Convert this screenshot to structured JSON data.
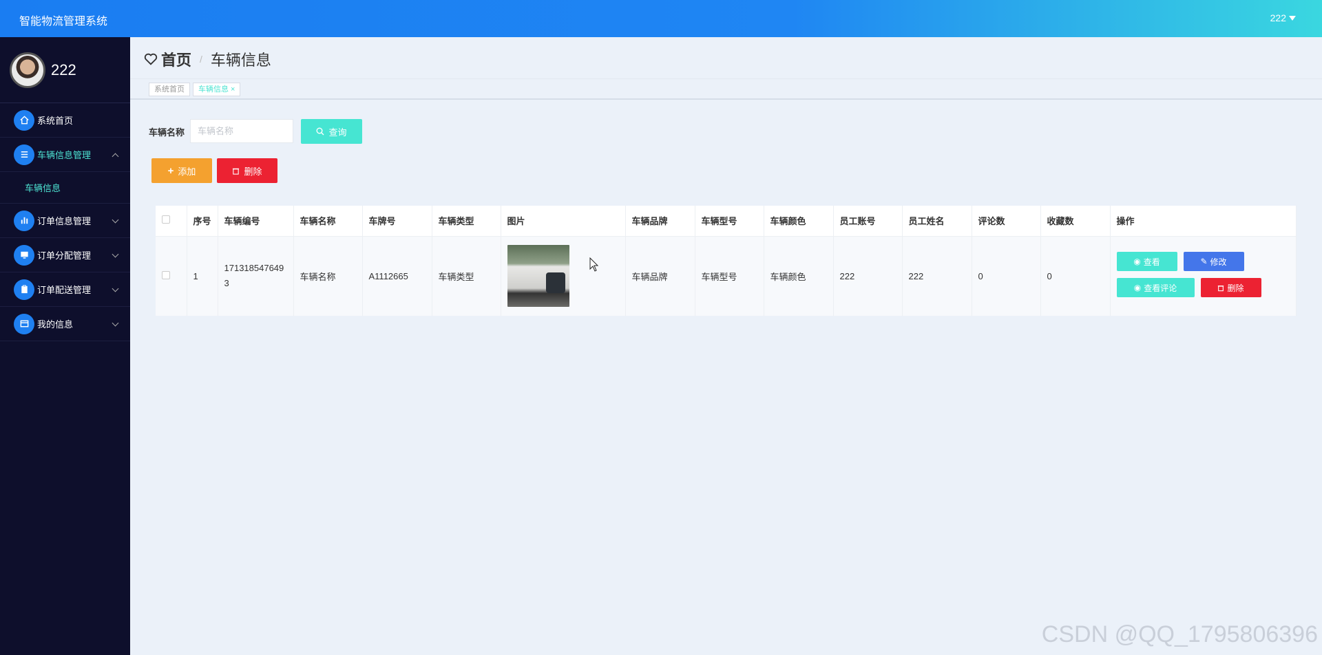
{
  "header": {
    "app_title": "智能物流管理系统",
    "user_label": "222"
  },
  "sidebar": {
    "profile_name": "222",
    "items": [
      {
        "label": "系统首页"
      },
      {
        "label": "车辆信息管理"
      },
      {
        "label": "订单信息管理"
      },
      {
        "label": "订单分配管理"
      },
      {
        "label": "订单配送管理"
      },
      {
        "label": "我的信息"
      }
    ],
    "sub_item": "车辆信息"
  },
  "breadcrumb": {
    "home": "首页",
    "separator": "/",
    "current": "车辆信息"
  },
  "tabs": [
    {
      "label": "系统首页"
    },
    {
      "label": "车辆信息"
    }
  ],
  "search": {
    "label": "车辆名称",
    "placeholder": "车辆名称",
    "button": "查询"
  },
  "actions": {
    "add": "添加",
    "delete": "删除"
  },
  "table": {
    "headers": [
      "序号",
      "车辆编号",
      "车辆名称",
      "车牌号",
      "车辆类型",
      "图片",
      "车辆品牌",
      "车辆型号",
      "车辆颜色",
      "员工账号",
      "员工姓名",
      "评论数",
      "收藏数",
      "操作"
    ],
    "rows": [
      {
        "index": "1",
        "vehicle_no": "1713185476493",
        "name": "车辆名称",
        "plate": "A1112665",
        "type": "车辆类型",
        "brand": "车辆品牌",
        "model": "车辆型号",
        "color": "车辆颜色",
        "staff_account": "222",
        "staff_name": "222",
        "comments": "0",
        "favorites": "0"
      }
    ],
    "ops": {
      "view": "查看",
      "edit": "修改",
      "view_comments": "查看评论",
      "delete": "删除"
    }
  },
  "watermark": "CSDN @QQ_1795806396",
  "colors": {
    "header_start": "#1a7df2",
    "header_end": "#3ad7e0",
    "sidebar_bg": "#0e0f2c",
    "accent": "#46e5d2",
    "warn": "#f4a12f",
    "danger": "#ec2232",
    "primary": "#4476ea"
  }
}
